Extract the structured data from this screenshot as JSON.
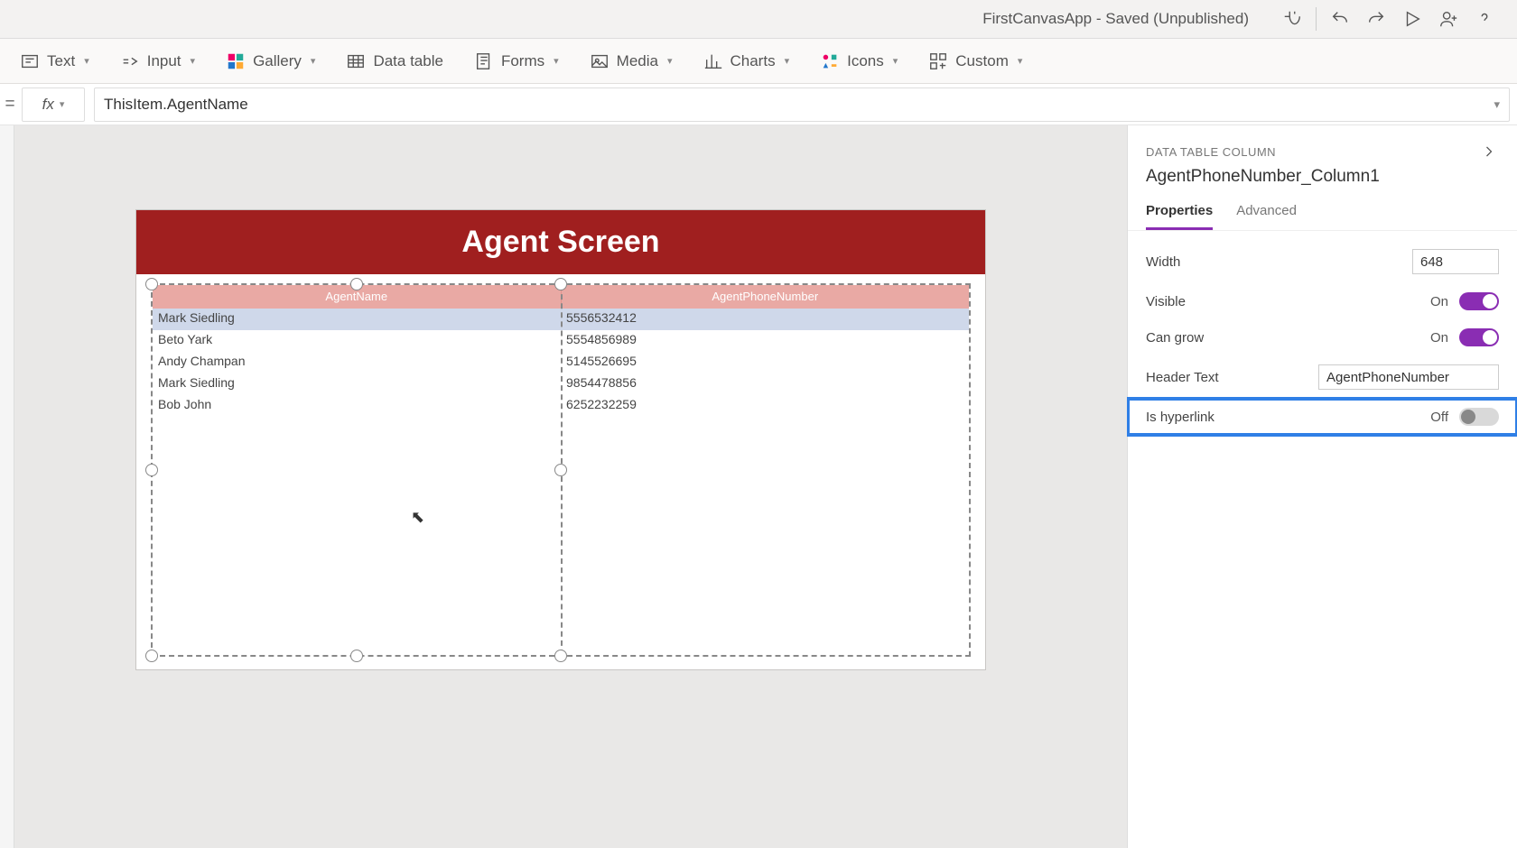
{
  "title_bar": {
    "app_title": "FirstCanvasApp - Saved (Unpublished)"
  },
  "ribbon": {
    "text": "Text",
    "input": "Input",
    "gallery": "Gallery",
    "data_table": "Data table",
    "forms": "Forms",
    "media": "Media",
    "charts": "Charts",
    "icons": "Icons",
    "custom": "Custom"
  },
  "formula": {
    "fx_label": "fx",
    "expression": "ThisItem.AgentName"
  },
  "canvas": {
    "screen_title": "Agent Screen",
    "columns": [
      "AgentName",
      "AgentPhoneNumber"
    ],
    "rows": [
      {
        "name": "Mark Siedling",
        "phone": "5556532412"
      },
      {
        "name": "Beto Yark",
        "phone": "5554856989"
      },
      {
        "name": "Andy Champan",
        "phone": "5145526695"
      },
      {
        "name": "Mark Siedling",
        "phone": "9854478856"
      },
      {
        "name": "Bob John",
        "phone": "6252232259"
      }
    ]
  },
  "right_panel": {
    "type_label": "DATA TABLE COLUMN",
    "control_name": "AgentPhoneNumber_Column1",
    "tabs": {
      "properties": "Properties",
      "advanced": "Advanced"
    },
    "props": {
      "width_label": "Width",
      "width_value": "648",
      "visible_label": "Visible",
      "visible_state": "On",
      "cangrow_label": "Can grow",
      "cangrow_state": "On",
      "headertext_label": "Header Text",
      "headertext_value": "AgentPhoneNumber",
      "ishyperlink_label": "Is hyperlink",
      "ishyperlink_state": "Off"
    }
  }
}
